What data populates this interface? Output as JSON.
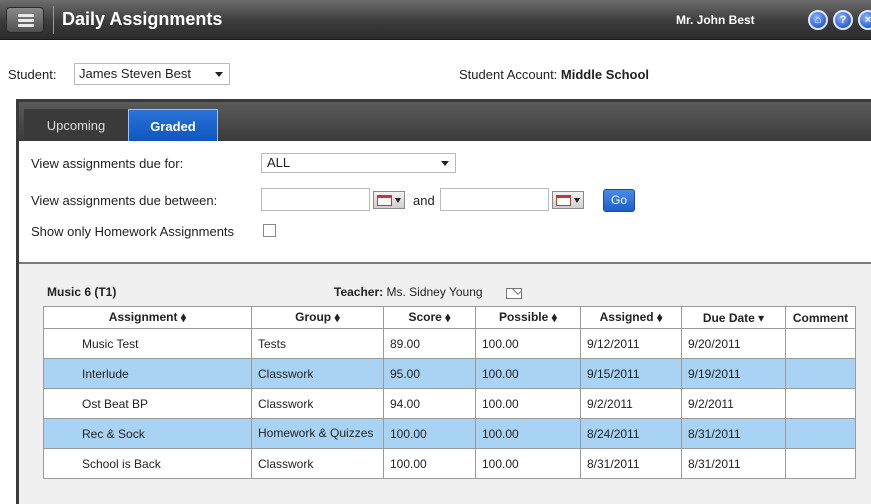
{
  "header": {
    "title": "Daily Assignments",
    "user": "Mr. John Best",
    "icons": [
      "home-icon",
      "help-icon",
      "close-icon"
    ]
  },
  "student_bar": {
    "student_label": "Student:",
    "student_value": "James Steven Best",
    "account_label": "Student Account:",
    "account_value": "Middle School"
  },
  "tabs": [
    {
      "label": "Upcoming",
      "active": false
    },
    {
      "label": "Graded",
      "active": true
    }
  ],
  "filters": {
    "due_for_label": "View assignments due for:",
    "due_for_value": "ALL",
    "between_label": "View assignments due between:",
    "start_date": "",
    "and_label": "and",
    "end_date": "",
    "go_label": "Go",
    "homework_label": "Show only Homework Assignments",
    "homework_checked": false
  },
  "course": {
    "title": "Music 6 (T1)",
    "teacher_label": "Teacher:",
    "teacher_name": "Ms. Sidney Young"
  },
  "table": {
    "columns": [
      "Assignment ⬧",
      "Group ⬧",
      "Score ⬧",
      "Possible ⬧",
      "Assigned ⬧",
      "Due Date ▾",
      "Comment"
    ],
    "rows": [
      {
        "assignment": "Music Test",
        "group": "Tests",
        "score": "89.00",
        "possible": "100.00",
        "assigned": "9/12/2011",
        "due": "9/20/2011",
        "comment": "",
        "highlight": false
      },
      {
        "assignment": "Interlude",
        "group": "Classwork",
        "score": "95.00",
        "possible": "100.00",
        "assigned": "9/15/2011",
        "due": "9/19/2011",
        "comment": "",
        "highlight": true
      },
      {
        "assignment": "Ost Beat BP",
        "group": "Classwork",
        "score": "94.00",
        "possible": "100.00",
        "assigned": "9/2/2011",
        "due": "9/2/2011",
        "comment": "",
        "highlight": false
      },
      {
        "assignment": "Rec & Sock",
        "group": "Homework & Quizzes",
        "score": "100.00",
        "possible": "100.00",
        "assigned": "8/24/2011",
        "due": "8/31/2011",
        "comment": "",
        "highlight": true
      },
      {
        "assignment": "School is Back",
        "group": "Classwork",
        "score": "100.00",
        "possible": "100.00",
        "assigned": "8/31/2011",
        "due": "8/31/2011",
        "comment": "",
        "highlight": false
      }
    ]
  },
  "colors": {
    "accent": "#1565c0",
    "row_highlight": "#a9d3f5",
    "topbar": "#3b3b3b"
  }
}
